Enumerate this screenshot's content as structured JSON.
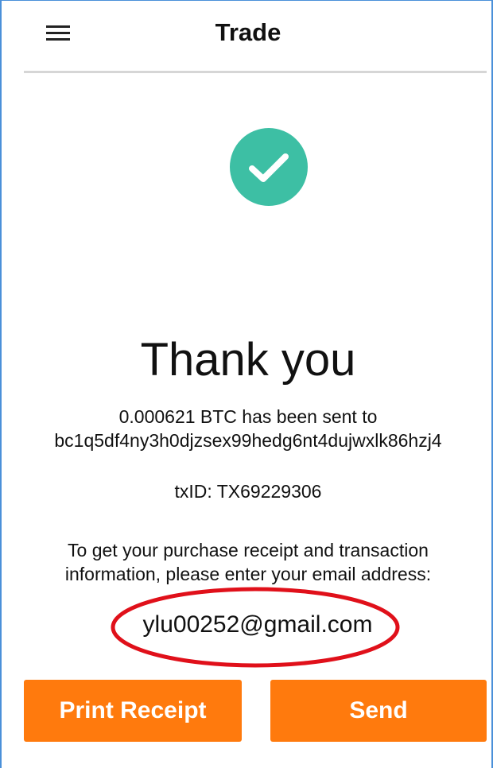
{
  "header": {
    "title": "Trade",
    "menu_icon": "hamburger-menu-icon"
  },
  "status": {
    "icon": "checkmark-circle-icon",
    "icon_color": "#3dbfa4"
  },
  "main": {
    "heading": "Thank you",
    "sent_line1": "0.000621 BTC has been sent to",
    "sent_line2": "bc1q5df4ny3h0djzsex99hedg6nt4dujwxlk86hzj4",
    "txid": "txID: TX69229306",
    "receipt_line1": "To get your purchase receipt and transaction",
    "receipt_line2": "information, please enter your email address:",
    "email": "ylu00252@gmail.com",
    "annotation_color": "#e0101a"
  },
  "actions": {
    "print_label": "Print Receipt",
    "send_label": "Send",
    "button_color": "#ff7a0d"
  }
}
